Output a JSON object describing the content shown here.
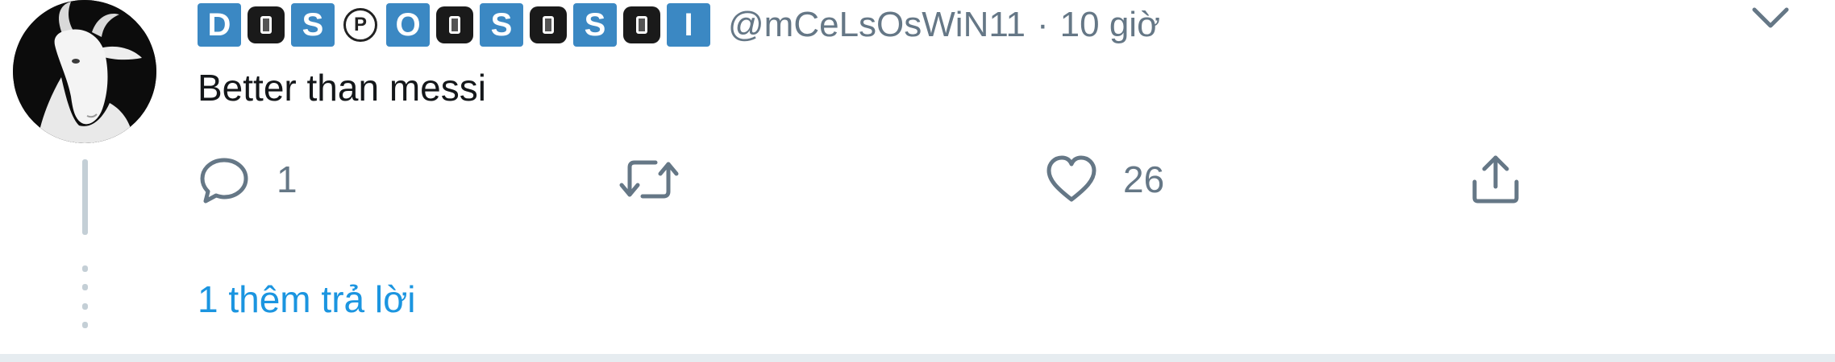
{
  "tweet": {
    "author": {
      "name_tiles": [
        {
          "kind": "letter",
          "char": "D"
        },
        {
          "kind": "dark",
          "char": ""
        },
        {
          "kind": "letter",
          "char": "S"
        },
        {
          "kind": "circle",
          "char": "P"
        },
        {
          "kind": "letter",
          "char": "O"
        },
        {
          "kind": "dark",
          "char": ""
        },
        {
          "kind": "letter",
          "char": "S"
        },
        {
          "kind": "dark",
          "char": ""
        },
        {
          "kind": "letter",
          "char": "S"
        },
        {
          "kind": "dark",
          "char": ""
        },
        {
          "kind": "letter",
          "char": "I"
        }
      ],
      "handle": "@mCeLsOsWiN11",
      "separator": "·",
      "time": "10 giờ",
      "avatar_icon": "goat-avatar"
    },
    "text": "Better than messi",
    "actions": {
      "reply_icon": "reply-icon",
      "reply_count": "1",
      "retweet_icon": "retweet-icon",
      "like_icon": "heart-icon",
      "like_count": "26",
      "share_icon": "share-icon"
    },
    "more_replies": "1 thêm trả lời",
    "menu_icon": "chevron-down-icon"
  },
  "colors": {
    "tile_blue": "#3b88c3",
    "muted": "#657786",
    "link": "#1b95e0",
    "text": "#14171a"
  }
}
